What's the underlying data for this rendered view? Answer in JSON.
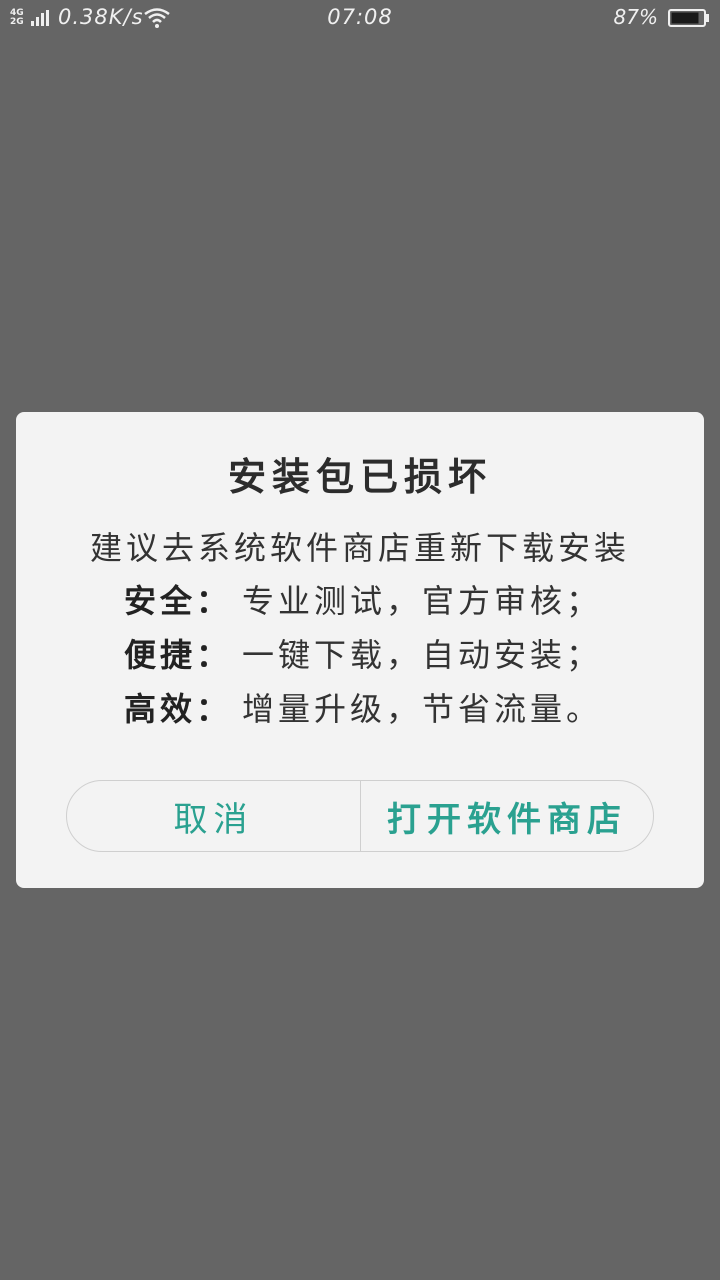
{
  "status_bar": {
    "network_type_top": "4G",
    "network_type_bottom": "2G",
    "net_speed": "0.38K/s",
    "time": "07:08",
    "battery_percent": "87%",
    "signal_icon": "signal-icon",
    "wifi_icon": "wifi-icon",
    "battery_icon": "battery-icon",
    "battery_level": 0.87
  },
  "dialog": {
    "title": "安装包已损坏",
    "message_line": "建议去系统软件商店重新下载安装",
    "features": [
      {
        "label": "安全：",
        "text": "专业测试，官方审核；"
      },
      {
        "label": "便捷：",
        "text": "一键下载，自动安装；"
      },
      {
        "label": "高效：",
        "text": "增量升级，节省流量。"
      }
    ],
    "cancel_label": "取消",
    "open_store_label": "打开软件商店"
  },
  "colors": {
    "overlay_background": "#656565",
    "dialog_background": "#f3f3f3",
    "accent": "#2aa190"
  }
}
